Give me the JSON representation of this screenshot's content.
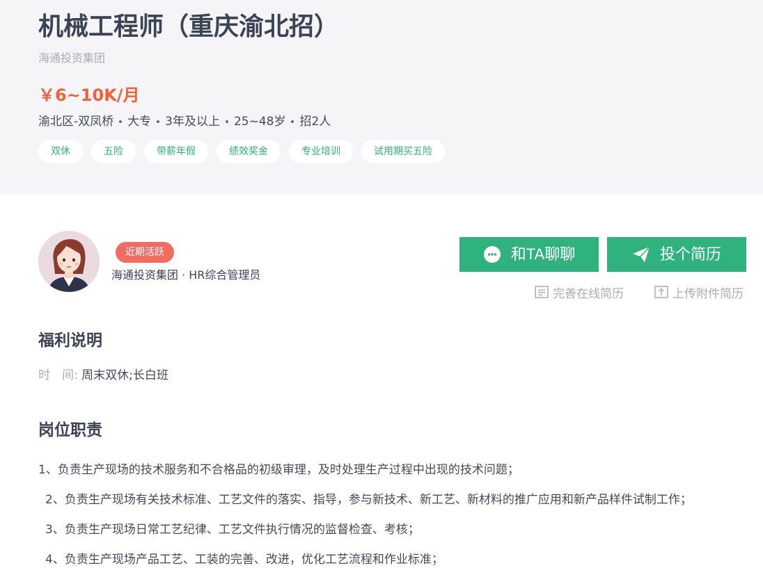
{
  "job": {
    "title": "机械工程师（重庆渝北招）",
    "company": "海通投资集团",
    "salary": "￥6~10K/月",
    "meta": [
      "渝北区-双凤桥",
      "大专",
      "3年及以上",
      "25~48岁",
      "招2人"
    ],
    "tags": [
      "双休",
      "五险",
      "带薪年假",
      "绩效奖金",
      "专业培训",
      "试用期买五险"
    ]
  },
  "recruiter": {
    "badge": "近期活跃",
    "info": "海通投资集团 · HR综合管理员"
  },
  "actions": {
    "chat_label": "和TA聊聊",
    "apply_label": "投个简历",
    "online_resume_label": "完善在线简历",
    "upload_resume_label": "上传附件简历"
  },
  "benefits": {
    "title": "福利说明",
    "time_label": "时　间:",
    "time_value": "周末双休;长白班"
  },
  "duties": {
    "title": "岗位职责",
    "items": [
      "1、负责生产现场的技术服务和不合格品的初级审理，及时处理生产过程中出现的技术问题；",
      "2、负责生产现场有关技术标准、工艺文件的落实、指导，参与新技术、新工艺、新材料的推广应用和新产品样件试制工作；",
      "3、负责生产现场日常工艺纪律、工艺文件执行情况的监督检查、考核；",
      "4、负责生产现场产品工艺、工装的完善、改进，优化工艺流程和作业标准；"
    ]
  },
  "colors": {
    "accent": "#2fb27e",
    "salary": "#f0623a",
    "badge": "#f26d61",
    "header_bg": "#f5f5f7"
  }
}
